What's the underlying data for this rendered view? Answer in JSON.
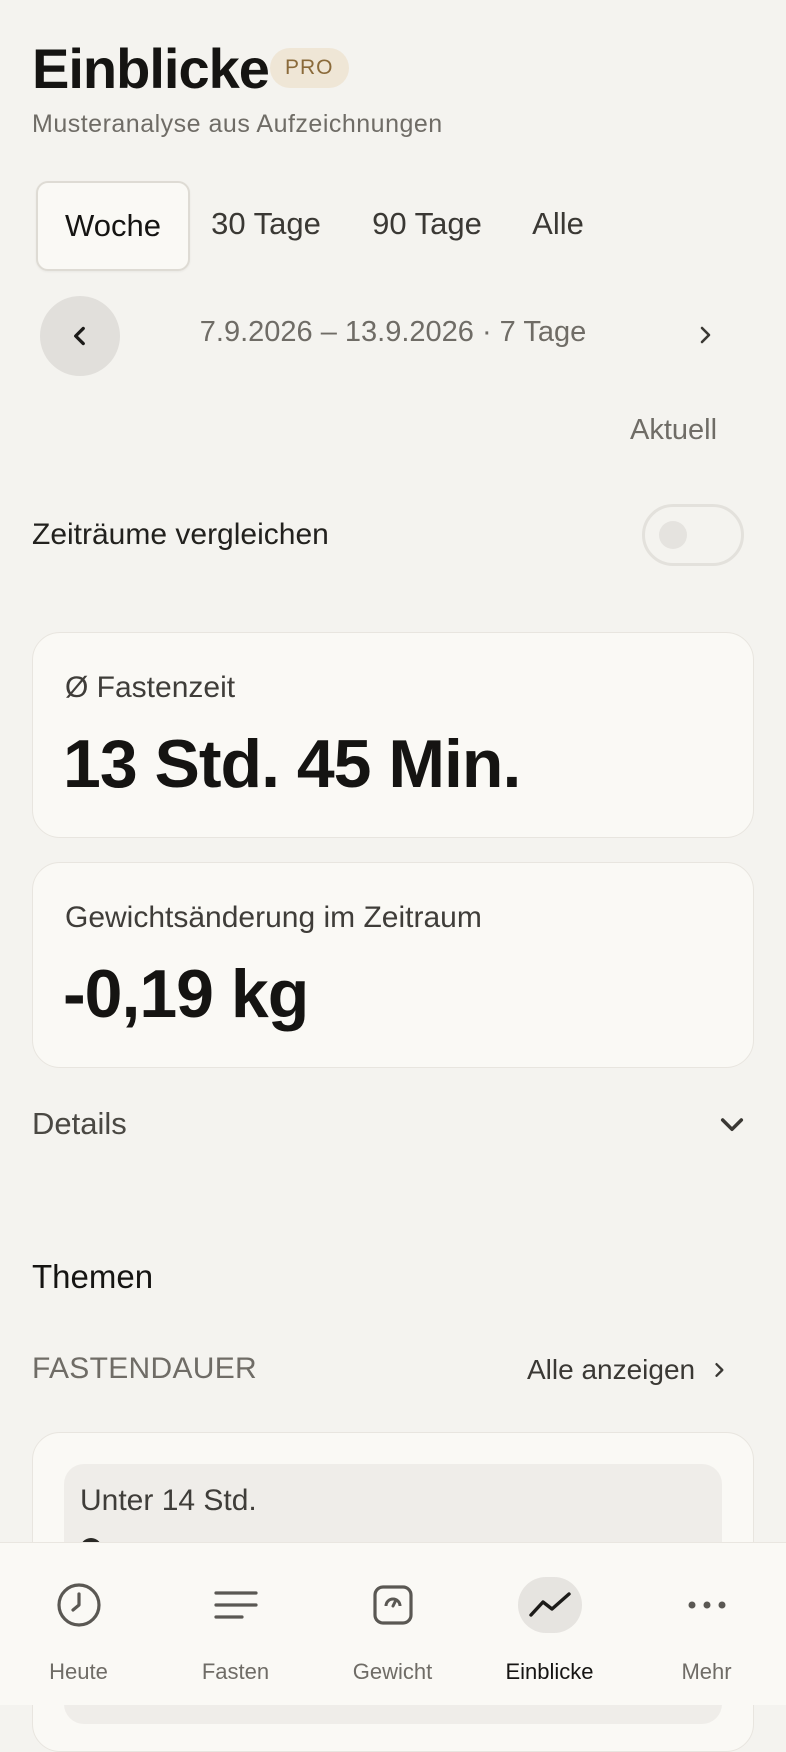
{
  "header": {
    "title": "Einblicke",
    "badge": "PRO",
    "subtitle": "Musteranalyse aus Aufzeichnungen"
  },
  "tabs": [
    {
      "label": "Woche",
      "active": true
    },
    {
      "label": "30 Tage",
      "active": false
    },
    {
      "label": "90 Tage",
      "active": false
    },
    {
      "label": "Alle",
      "active": false
    }
  ],
  "period": {
    "range": "7.9.2026 – 13.9.2026 · 7 Tage",
    "current_label": "Aktuell",
    "prev_icon": "chevron-left-icon",
    "next_icon": "chevron-right-icon"
  },
  "compare": {
    "label": "Zeiträume vergleichen",
    "enabled": false
  },
  "stats": [
    {
      "label": "Ø Fastenzeit",
      "value": "13 Std. 45 Min."
    },
    {
      "label": "Gewichtsänderung im Zeitraum",
      "value": "-0,19 kg"
    }
  ],
  "details": {
    "label": "Details",
    "icon": "chevron-down-icon"
  },
  "themes": {
    "heading": "Themen",
    "section_title": "FASTENDAUER",
    "show_all": "Alle anzeigen",
    "card_title": "Unter 14 Std."
  },
  "bottom_nav": [
    {
      "label": "Heute",
      "icon": "clock-icon",
      "active": false
    },
    {
      "label": "Fasten",
      "icon": "lines-icon",
      "active": false
    },
    {
      "label": "Gewicht",
      "icon": "scale-icon",
      "active": false
    },
    {
      "label": "Einblicke",
      "icon": "trend-icon",
      "active": true
    },
    {
      "label": "Mehr",
      "icon": "more-icon",
      "active": false
    }
  ],
  "colors": {
    "background": "#f4f3ef",
    "card": "#faf9f5",
    "badge_bg": "#efe6d6",
    "badge_text": "#8a6a3a",
    "text_primary": "#151412",
    "text_secondary": "#6f6c66"
  }
}
